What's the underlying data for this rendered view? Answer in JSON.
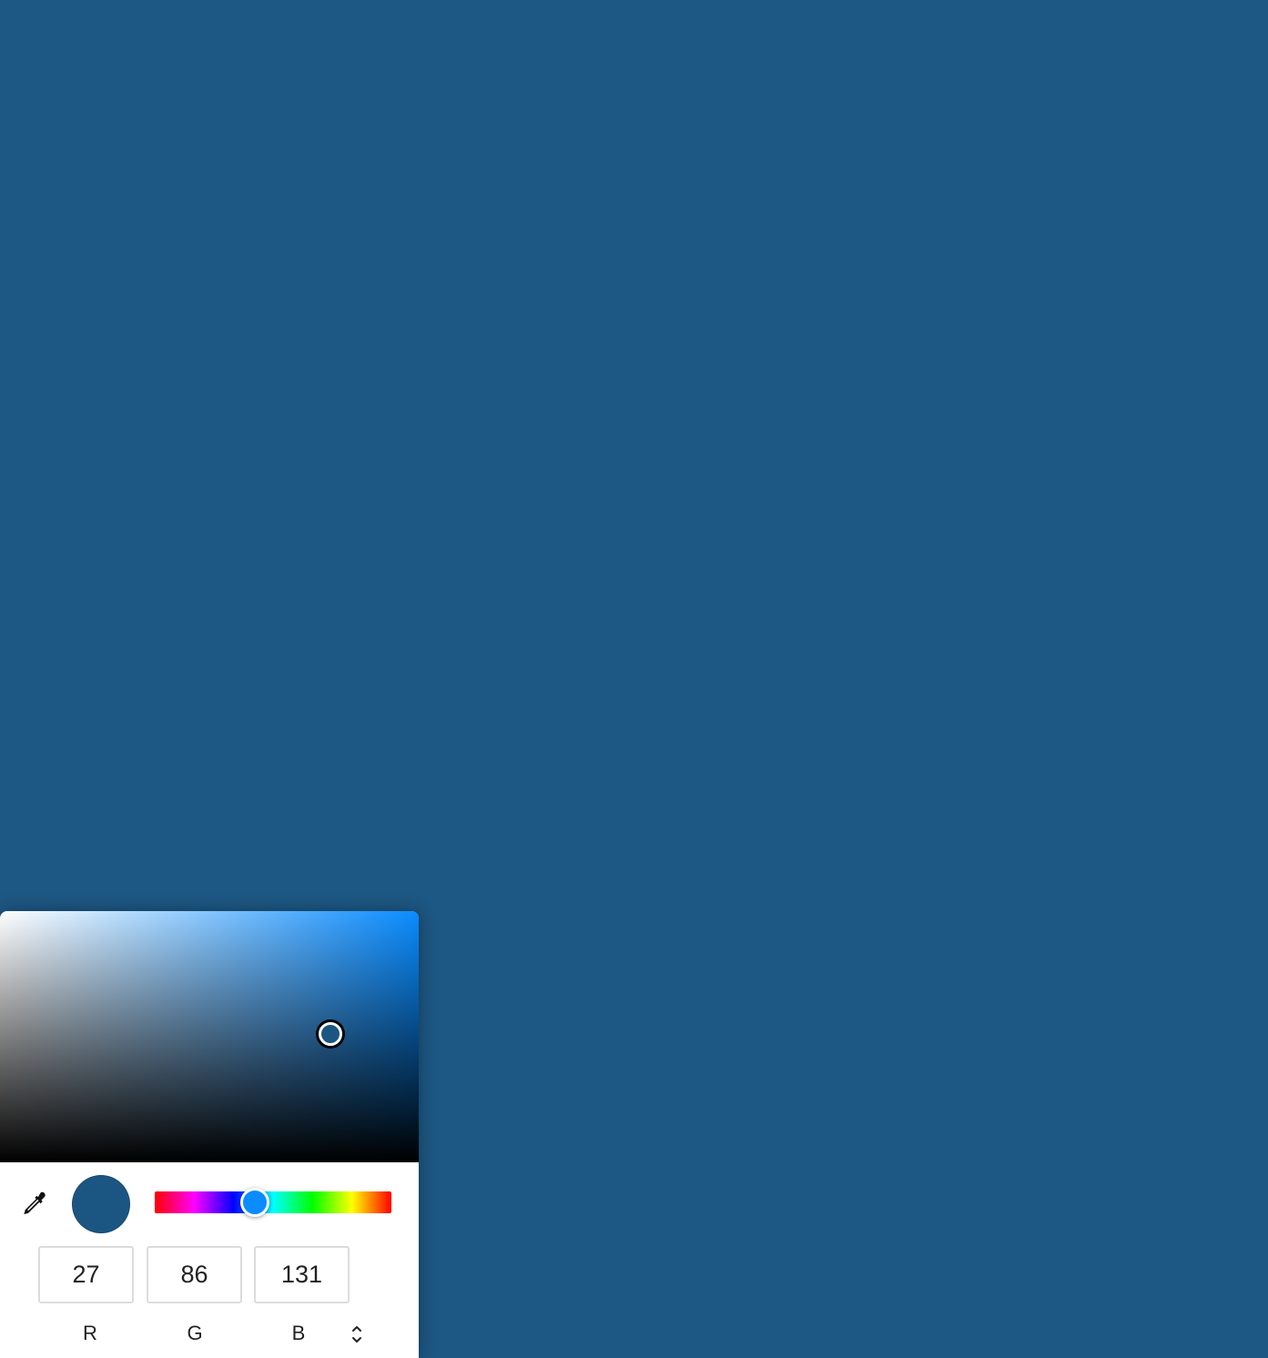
{
  "background_color": "#1d5783",
  "picker": {
    "hue_degrees": 208,
    "hue_color": "#0a8cff",
    "saturation": 0.79,
    "brightness": 0.51,
    "selected_color": "#1b5683",
    "eyedropper_icon": "eyedropper-icon",
    "mode_toggle_icon": "chevron-up-down-icon",
    "channels": [
      {
        "label": "R",
        "value": "27"
      },
      {
        "label": "G",
        "value": "86"
      },
      {
        "label": "B",
        "value": "131"
      }
    ]
  }
}
